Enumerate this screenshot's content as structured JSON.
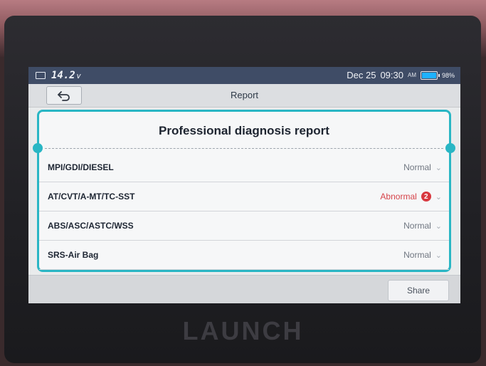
{
  "status_bar": {
    "voltage": "14.2",
    "voltage_unit": "v",
    "date": "Dec 25",
    "time": "09:30",
    "am_pm": "AM",
    "battery_percent": "98%",
    "battery_level": 0.98
  },
  "header": {
    "title": "Report"
  },
  "report": {
    "title": "Professional diagnosis report",
    "rows": [
      {
        "label": "MPI/GDI/DIESEL",
        "status": "Normal",
        "badge": ""
      },
      {
        "label": "AT/CVT/A-MT/TC-SST",
        "status": "Abnormal",
        "badge": "2"
      },
      {
        "label": "ABS/ASC/ASTC/WSS",
        "status": "Normal",
        "badge": ""
      },
      {
        "label": "SRS-Air Bag",
        "status": "Normal",
        "badge": ""
      }
    ]
  },
  "footer": {
    "share_label": "Share"
  },
  "device": {
    "brand": "LAUNCH"
  },
  "colors": {
    "accent": "#29b6c4",
    "alert": "#d8383f",
    "statusbar": "#3f4c66"
  }
}
